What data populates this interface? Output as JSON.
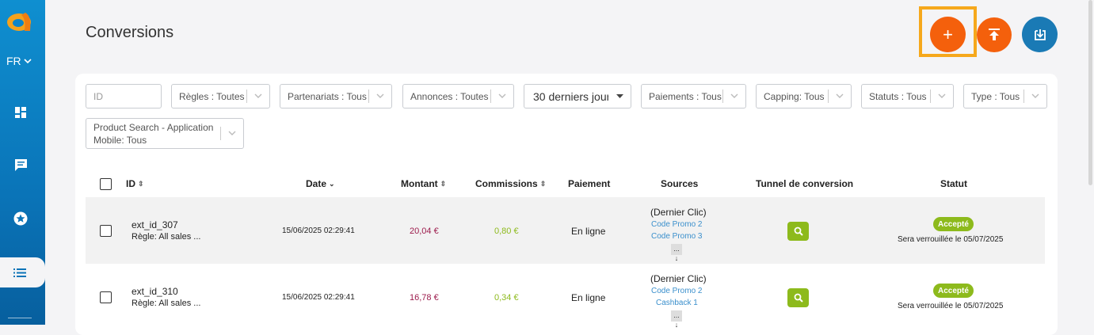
{
  "sidebar": {
    "language": "FR",
    "items": [
      {
        "icon": "dashboard-icon"
      },
      {
        "icon": "chat-icon"
      },
      {
        "icon": "star-icon"
      },
      {
        "icon": "list-icon",
        "active": true
      }
    ]
  },
  "page": {
    "title": "Conversions"
  },
  "actions": {
    "add": "+",
    "upload_icon": "upload-icon",
    "download_icon": "download-icon"
  },
  "filters": {
    "id_placeholder": "ID",
    "rules": "Règles : Toutes",
    "partnerships": "Partenariats : Tous",
    "ads": "Annonces : Toutes",
    "period": "30 derniers jours",
    "payments": "Paiements : Tous",
    "capping": "Capping: Tous",
    "statuses": "Statuts : Tous",
    "type": "Type : Tous",
    "product_search": "Product Search - Application Mobile: Tous"
  },
  "table": {
    "headers": {
      "id": "ID",
      "date": "Date",
      "amount": "Montant",
      "commissions": "Commissions",
      "payment": "Paiement",
      "sources": "Sources",
      "funnel": "Tunnel de conversion",
      "status": "Statut"
    },
    "rows": [
      {
        "id": "ext_id_307",
        "rule": "Règle: All sales ...",
        "date": "15/06/2025 02:29:41",
        "amount": "20,04 €",
        "commission": "0,80 €",
        "payment": "En ligne",
        "source_title": "(Dernier Clic)",
        "source_1": "Code Promo 2",
        "source_2": "Code Promo 3",
        "more": "... ↓",
        "status": "Accepté",
        "lock": "Sera verrouillée le 05/07/2025"
      },
      {
        "id": "ext_id_310",
        "rule": "Règle: All sales ...",
        "date": "15/06/2025 02:29:41",
        "amount": "16,78 €",
        "commission": "0,34 €",
        "payment": "En ligne",
        "source_title": "(Dernier Clic)",
        "source_1": "Code Promo 2",
        "source_2": "Cashback 1",
        "more": "... ↓",
        "status": "Accepté",
        "lock": "Sera verrouillée le 05/07/2025"
      }
    ]
  },
  "colors": {
    "accent_orange": "#f4600c",
    "accent_blue": "#1a7ab5",
    "success_green": "#8dba1c",
    "amount_red": "#9c1b4c",
    "link_blue": "#3a8fcc",
    "highlight": "#f6a81c"
  }
}
